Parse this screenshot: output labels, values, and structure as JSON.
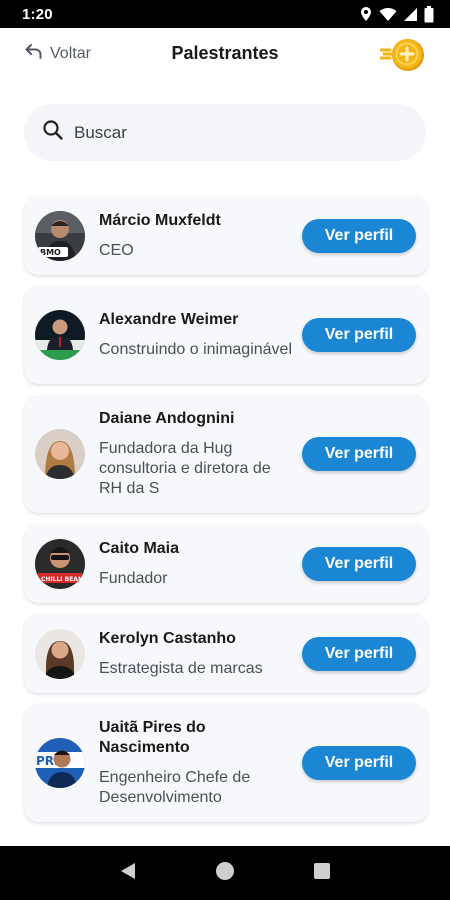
{
  "status_bar": {
    "time": "1:20",
    "icons": [
      "location-icon",
      "wifi-icon",
      "signal-icon",
      "battery-icon"
    ]
  },
  "header": {
    "back_label": "Voltar",
    "title": "Palestrantes",
    "coin_icon": "coin-icon"
  },
  "search": {
    "placeholder": "Buscar",
    "value": ""
  },
  "colors": {
    "accent": "#1a86d4",
    "card_bg": "#f7f8fb",
    "coin": "#f5b514"
  },
  "speakers": [
    {
      "name": "Márcio Muxfeldt",
      "role": "CEO",
      "button_label": "Ver perfil"
    },
    {
      "name": "Alexandre Weimer",
      "role": "Construindo o inimaginável",
      "button_label": "Ver perfil"
    },
    {
      "name": "Daiane Andognini",
      "role": "Fundadora da Hug consultoria e diretora de RH da S",
      "button_label": "Ver perfil"
    },
    {
      "name": "Caito Maia",
      "role": "Fundador",
      "button_label": "Ver perfil"
    },
    {
      "name": "Kerolyn Castanho",
      "role": "Estrategista de marcas",
      "button_label": "Ver perfil"
    },
    {
      "name": "Uaitã Pires do Nascimento",
      "role": "Engenheiro Chefe de Desenvolvimento",
      "button_label": "Ver perfil"
    }
  ],
  "nav_bar": {
    "items": [
      "back-triangle-icon",
      "home-circle-icon",
      "recents-square-icon"
    ]
  }
}
